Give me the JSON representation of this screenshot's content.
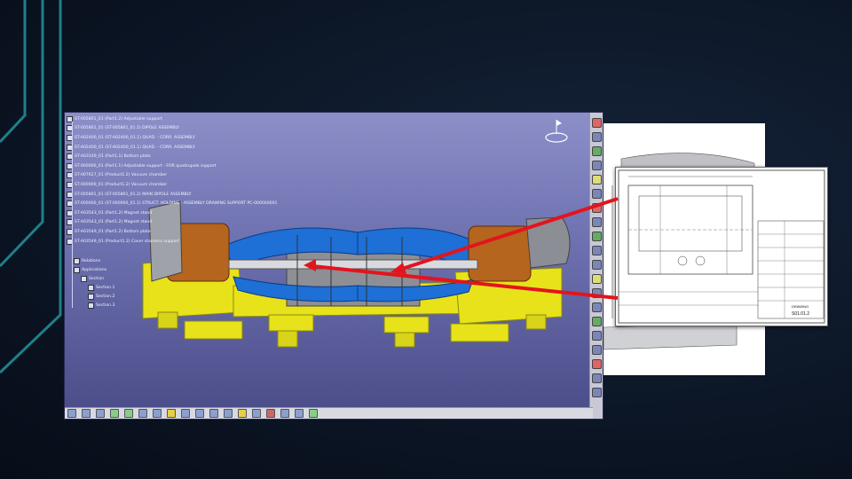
{
  "cad_window": {
    "product_tree": {
      "items": [
        "ST-005801_01 (Part1.2) Adjustable support",
        "ST-005801_01 (ST-005801_01.2) DIPOLE ASSEMBLY",
        "ST-A02400_01 (ST-A02400_01.1) QUAD. - CORR. ASSEMBLY",
        "ST-A02400_01 (ST-A02400_01.1) QUAD. - CORR. ASSEMBLY",
        "ST-A03149_01 (Part1.1) Bottom plate",
        "ST-000000_01 (Part1.1) Adjustable support - FOR quadrupole support",
        "ST-007627_01 (Product1.2) Vacuum chamber",
        "ST-000000_01 (Product1.2) Vacuum chamber",
        "ST-005801_01 (ST-005801_01.2) MAIN DIPOLE ASSEMBLY",
        "ST-000000_01 (ST-000000_01.1) STRUCT. HOLDING - ASSEMBLY DRAWING SUPPORT PC-000000001",
        "ST-A03543_01 (Part1.2) Magnet stand",
        "ST-A03543_01 (Part1.2) Magnet stand",
        "ST-A03549_01 (Part1.2) Bottom plate",
        "ST-A03549_01 (Product1.2) Cover stainless support"
      ],
      "sub_items": [
        "Relations",
        "Applications",
        "Section",
        "Section.1",
        "Section.2",
        "Section.3"
      ]
    },
    "right_toolbar_icons": [
      "sketch-icon",
      "pad-icon",
      "pocket-icon",
      "fillet-icon",
      "measure-icon",
      "section-icon",
      "clash-icon",
      "snap-icon",
      "fly-icon",
      "zoom-icon",
      "pan-icon",
      "rotate-icon",
      "fit-icon",
      "view-icon",
      "render-icon",
      "light-icon",
      "hide-icon",
      "swap-icon",
      "grid-icon",
      "update-icon"
    ],
    "bottom_toolbar_icons": [
      "select-icon",
      "copy-icon",
      "paste-icon",
      "undo-icon",
      "redo-icon",
      "fit-all-icon",
      "pan-icon",
      "rotate-icon",
      "zoom-in-icon",
      "zoom-out-icon",
      "normal-view-icon",
      "multi-view-icon",
      "iso-view-icon",
      "shading-icon",
      "hide-show-icon",
      "swap-space-icon",
      "render-icon",
      "measure-icon"
    ],
    "colors": {
      "background_top": "#8c8fc8",
      "background_bottom": "#4a4c88",
      "support_yellow": "#e8e21a",
      "coil_blue": "#1e6fd6",
      "coil_copper": "#b5651d"
    }
  },
  "drawing": {
    "title_block_text": "DRAWING",
    "sheet_number": "S01.01.2"
  },
  "annotation_arrow_color": "#e3141d"
}
